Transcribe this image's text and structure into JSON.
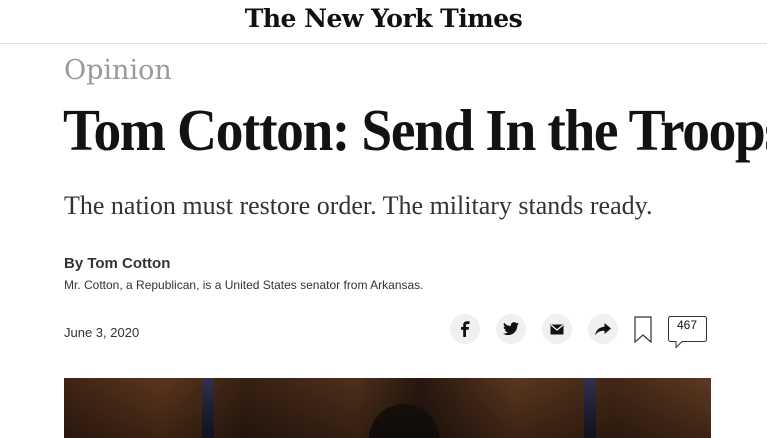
{
  "masthead": {
    "logo_text": "The New York Times"
  },
  "article": {
    "section": "Opinion",
    "headline": "Tom Cotton: Send In the Troops",
    "summary": "The nation must restore order. The military stands ready.",
    "byline": "By Tom Cotton",
    "bio": "Mr. Cotton, a Republican, is a United States senator from Arkansas.",
    "date": "June 3, 2020"
  },
  "share_tools": {
    "icons": [
      "facebook-icon",
      "twitter-icon",
      "email-icon",
      "share-icon",
      "bookmark-icon",
      "comments-icon"
    ],
    "comment_count": "467"
  },
  "colors": {
    "section": "#999999",
    "button_bg": "#f0f0f0",
    "text": "#121212"
  },
  "hero_image": {
    "description_icon": "photo"
  }
}
